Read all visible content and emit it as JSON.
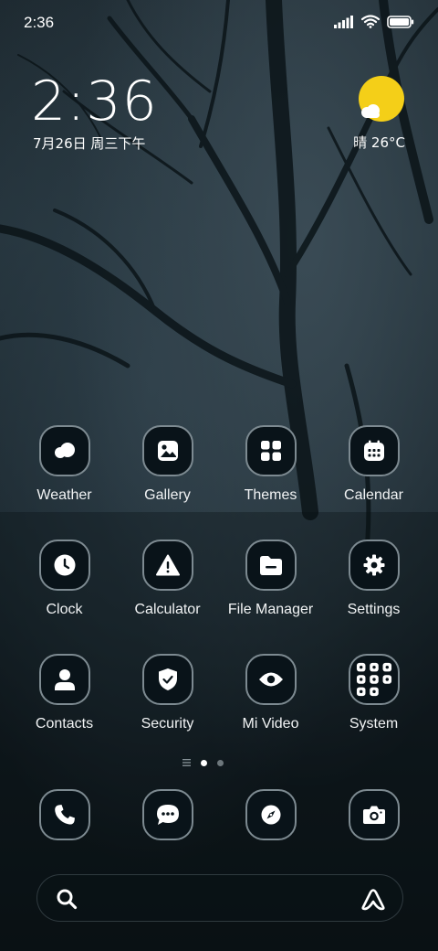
{
  "status_bar": {
    "time": "2:36"
  },
  "widget": {
    "clock": "2:36",
    "date": "7月26日 周三下午",
    "weather": "晴 26°C",
    "sun_color": "#f4cf18"
  },
  "apps": [
    {
      "label": "Weather",
      "icon": "weather-icon"
    },
    {
      "label": "Gallery",
      "icon": "gallery-icon"
    },
    {
      "label": "Themes",
      "icon": "themes-icon"
    },
    {
      "label": "Calendar",
      "icon": "calendar-icon"
    },
    {
      "label": "Clock",
      "icon": "clock-icon"
    },
    {
      "label": "Calculator",
      "icon": "calculator-icon"
    },
    {
      "label": "File Manager",
      "icon": "file-manager-icon"
    },
    {
      "label": "Settings",
      "icon": "settings-icon"
    },
    {
      "label": "Contacts",
      "icon": "contacts-icon"
    },
    {
      "label": "Security",
      "icon": "security-icon"
    },
    {
      "label": "Mi Video",
      "icon": "mi-video-icon"
    },
    {
      "label": "System",
      "icon": "system-folder-icon"
    }
  ],
  "page_indicator": {
    "pages": 2,
    "active": 1
  },
  "dock": [
    {
      "icon": "phone-icon"
    },
    {
      "icon": "messaging-icon"
    },
    {
      "icon": "browser-icon"
    },
    {
      "icon": "camera-icon"
    }
  ],
  "colors": {
    "icon_border": "#7d8a91",
    "icon_bg": "#091319"
  }
}
